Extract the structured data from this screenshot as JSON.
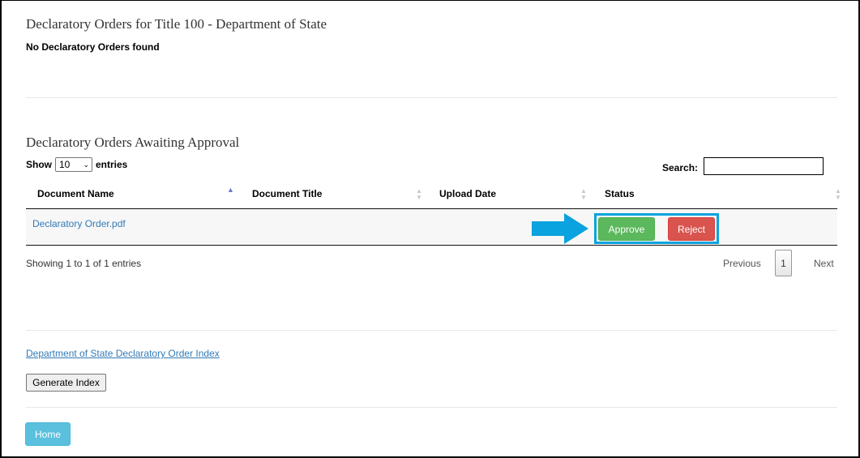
{
  "orders": {
    "title": "Declaratory Orders for Title 100 - Department of State",
    "empty_message": "No Declaratory Orders found"
  },
  "awaiting": {
    "title": "Declaratory Orders Awaiting Approval",
    "length": {
      "prefix": "Show",
      "value": "10",
      "suffix": "entries"
    },
    "search": {
      "label": "Search:",
      "value": ""
    },
    "columns": [
      "Document Name",
      "Document Title",
      "Upload Date",
      "Status"
    ],
    "sorted_column": "Document Name",
    "rows": [
      {
        "document_name": "Declaratory Order.pdf",
        "document_title": "",
        "upload_date": "",
        "actions": {
          "approve": "Approve",
          "reject": "Reject"
        }
      }
    ],
    "info": "Showing 1 to 1 of 1 entries",
    "pagination": {
      "previous": "Previous",
      "current": "1",
      "next": "Next"
    }
  },
  "index": {
    "link_text": "Department of State Declaratory Order Index",
    "generate_label": "Generate Index"
  },
  "nav": {
    "home_label": "Home"
  },
  "colors": {
    "approve": "#5cb85c",
    "reject": "#d9534f",
    "home": "#5bc0de",
    "link": "#337ab7",
    "highlight": "#0aa2df"
  },
  "icons": {
    "callout": "arrow-right-icon",
    "sort": "sort-icon",
    "dropdown": "chevron-down-icon"
  }
}
